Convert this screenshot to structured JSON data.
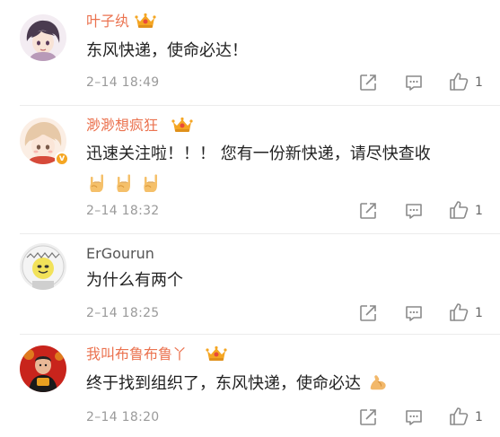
{
  "comments": [
    {
      "username": "叶子纨",
      "text": "东风快递，使命必达！",
      "time": "2–14 18:49",
      "likes": "1",
      "vip": true,
      "verified": false
    },
    {
      "username": "渺渺想疯狂",
      "text": "迅速关注啦！！！ 您有一份新快递，请尽快查收",
      "emojis": [
        "rock-hand-emoji",
        "rock-hand-emoji",
        "rock-hand-emoji"
      ],
      "time": "2–14 18:32",
      "likes": "1",
      "vip": true,
      "verified": true
    },
    {
      "username": "ErGourun",
      "text": "为什么有两个",
      "time": "2–14 18:25",
      "likes": "1",
      "vip": false,
      "verified": false
    },
    {
      "username": "我叫布鲁布鲁丫",
      "text": "终于找到组织了，东风快递，使命必达",
      "trailing_emoji": "flexed-biceps-emoji",
      "time": "2–14 18:20",
      "likes": "1",
      "vip": true,
      "verified": false
    }
  ],
  "colors": {
    "vip_name": "#eb7350",
    "plain_name": "#555555",
    "text": "#222222",
    "meta": "#9a9a9a",
    "separator": "#ececec",
    "crown": "#f5a623"
  },
  "icons": {
    "share": "share-icon",
    "reply": "comment-icon",
    "like": "thumbs-up-icon"
  }
}
